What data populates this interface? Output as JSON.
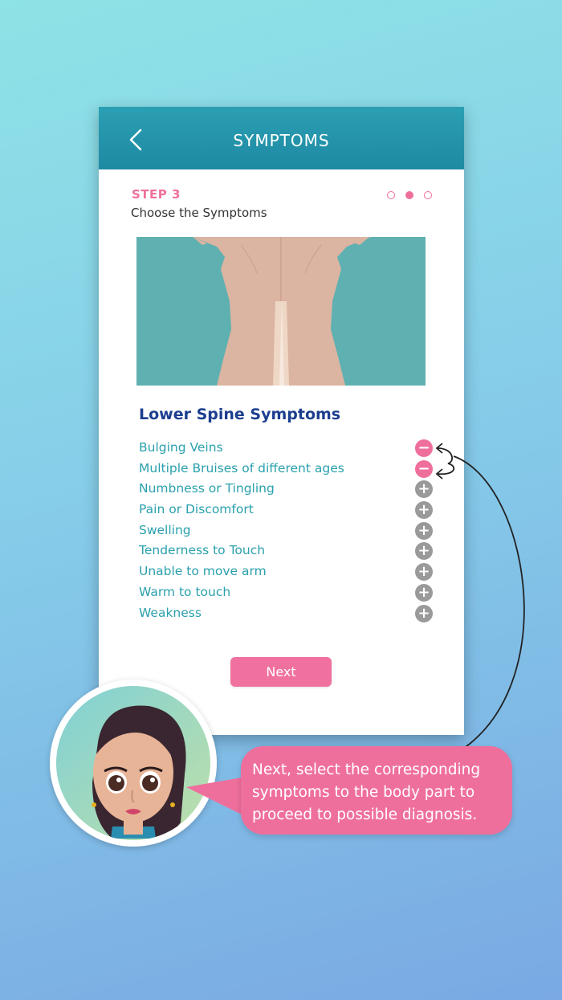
{
  "header": {
    "title": "SYMPTOMS",
    "back_icon": "chevron-left-icon"
  },
  "step": {
    "label": "STEP 3",
    "subtitle": "Choose the Symptoms",
    "total": 3,
    "current": 2
  },
  "section": {
    "title": "Lower Spine Symptoms"
  },
  "symptoms": [
    {
      "label": "Bulging Veins",
      "selected": true
    },
    {
      "label": "Multiple Bruises of different ages",
      "selected": true
    },
    {
      "label": "Numbness or Tingling",
      "selected": false
    },
    {
      "label": "Pain or Discomfort",
      "selected": false
    },
    {
      "label": "Swelling",
      "selected": false
    },
    {
      "label": "Tenderness to Touch",
      "selected": false
    },
    {
      "label": "Unable to move arm",
      "selected": false
    },
    {
      "label": "Warm to touch",
      "selected": false
    },
    {
      "label": "Weakness",
      "selected": false
    }
  ],
  "actions": {
    "next_label": "Next"
  },
  "tooltip": {
    "text": "Next, select the corresponding symptoms to the body part to proceed to possible diagnosis."
  },
  "colors": {
    "accent": "#ef6f9c",
    "header": "#1e8aa3",
    "symptom_text": "#2aa0ad",
    "section_title": "#1c3e8f"
  }
}
